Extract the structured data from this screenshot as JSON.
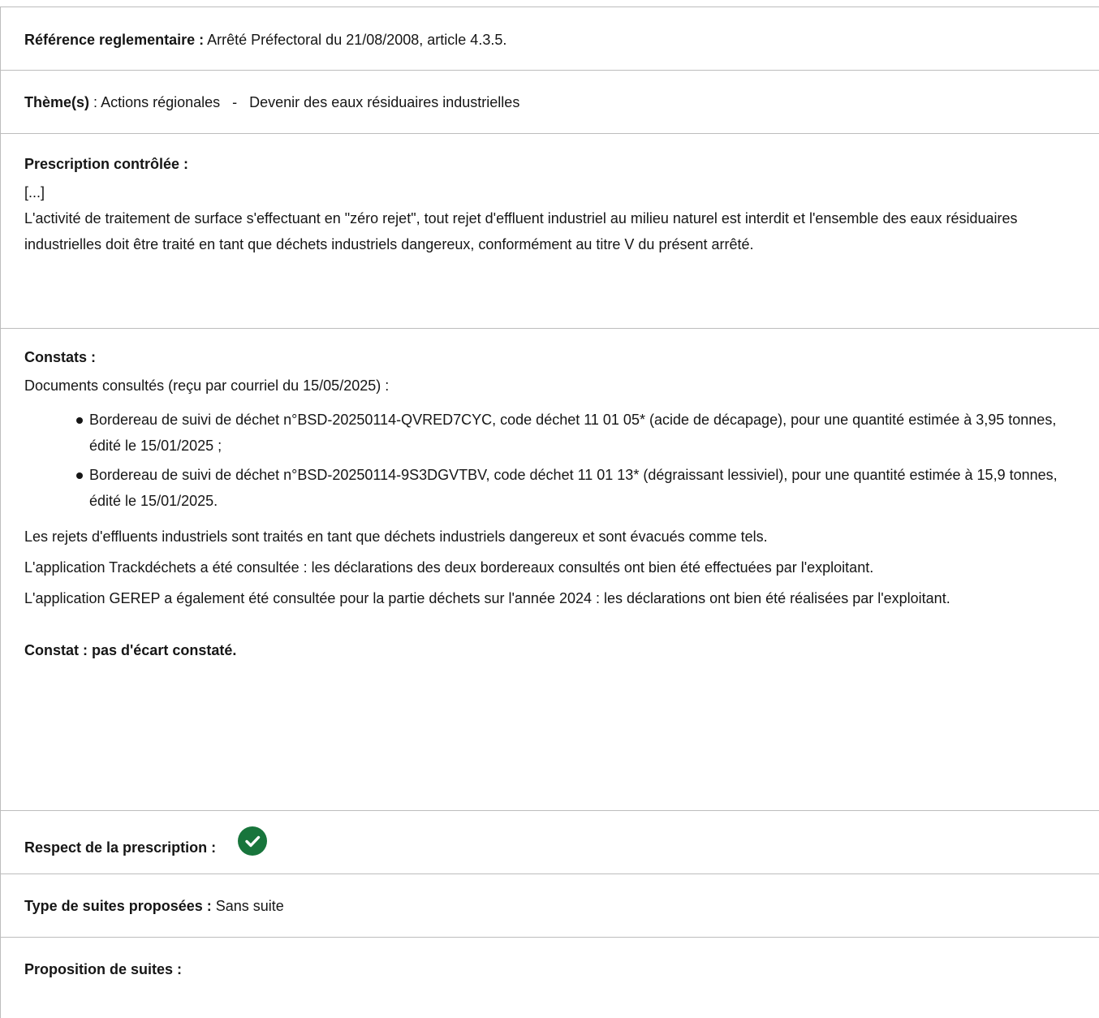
{
  "reference": {
    "label": "Référence reglementaire :",
    "value": "Arrêté Préfectoral du 21/08/2008, article 4.3.5."
  },
  "theme": {
    "label": "Thème(s)",
    "separator": ":",
    "value": "Actions régionales   -   Devenir des eaux résiduaires industrielles"
  },
  "prescription": {
    "label": "Prescription contrôlée :",
    "ellipsis": "[...]",
    "text": "L'activité de traitement de surface s'effectuant en \"zéro rejet\", tout rejet d'effluent industriel au milieu naturel est interdit et l'ensemble des eaux résiduaires industrielles doit être traité en tant que déchets industriels dangereux, conformément au titre V du présent arrêté."
  },
  "constats": {
    "label": "Constats :",
    "intro": "Documents consultés (reçu par courriel du 15/05/2025) :",
    "documents": [
      "Bordereau de suivi de déchet n°BSD-20250114-QVRED7CYC, code déchet 11 01 05* (acide de décapage), pour une quantité estimée à 3,95 tonnes, édité le 15/01/2025 ;",
      "Bordereau de suivi de déchet n°BSD-20250114-9S3DGVTBV, code déchet 11 01 13* (dégraissant lessiviel), pour une quantité estimée à 15,9 tonnes, édité le 15/01/2025."
    ],
    "paragraphs": [
      "Les rejets d'effluents industriels sont traités en tant que déchets industriels dangereux et sont évacués comme tels.",
      "L'application Trackdéchets a été consultée : les déclarations des deux bordereaux consultés ont bien été effectuées par l'exploitant.",
      "L'application GEREP a également été consultée pour la partie déchets sur l'année 2024 : les déclarations ont bien été réalisées par l'exploitant."
    ],
    "conclusion": "Constat : pas d'écart constaté."
  },
  "respect": {
    "label": "Respect de la prescription :",
    "status_icon": "check-circle-icon",
    "status_color": "#18753c"
  },
  "type_suites": {
    "label": "Type de suites proposées :",
    "value": "Sans suite"
  },
  "proposition": {
    "label": "Proposition de suites :"
  }
}
